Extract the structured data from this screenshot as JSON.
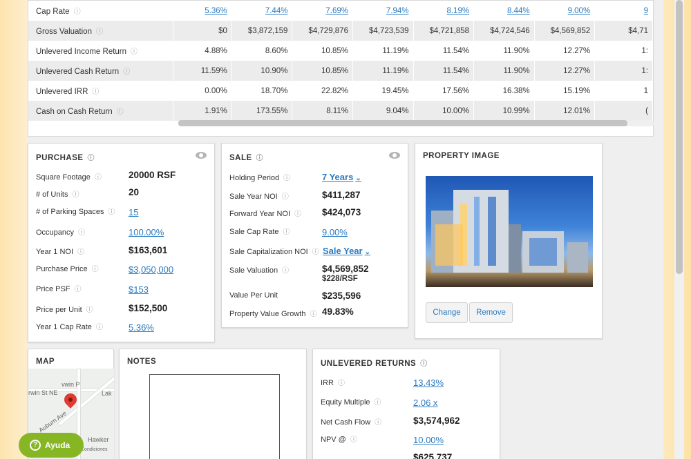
{
  "metrics_table": {
    "rows": [
      {
        "label": "Cap Rate",
        "link": true,
        "values": [
          "5.36%",
          "7.44%",
          "7.69%",
          "7.94%",
          "8.19%",
          "8.44%",
          "9.00%",
          "9"
        ]
      },
      {
        "label": "Gross Valuation",
        "link": false,
        "values": [
          "$0",
          "$3,872,159",
          "$4,729,876",
          "$4,723,539",
          "$4,721,858",
          "$4,724,546",
          "$4,569,852",
          "$4,71"
        ]
      },
      {
        "label": "Unlevered Income Return",
        "link": false,
        "values": [
          "4.88%",
          "8.60%",
          "10.85%",
          "11.19%",
          "11.54%",
          "11.90%",
          "12.27%",
          "1:"
        ]
      },
      {
        "label": "Unlevered Cash Return",
        "link": false,
        "values": [
          "11.59%",
          "10.90%",
          "10.85%",
          "11.19%",
          "11.54%",
          "11.90%",
          "12.27%",
          "1:"
        ]
      },
      {
        "label": "Unlevered IRR",
        "link": false,
        "values": [
          "0.00%",
          "18.70%",
          "22.82%",
          "19.45%",
          "17.56%",
          "16.38%",
          "15.19%",
          "1"
        ]
      },
      {
        "label": "Cash on Cash Return",
        "link": false,
        "values": [
          "1.91%",
          "173.55%",
          "8.11%",
          "9.04%",
          "10.00%",
          "10.99%",
          "12.01%",
          "("
        ]
      }
    ]
  },
  "purchase": {
    "title": "PURCHASE",
    "square_footage_label": "Square Footage",
    "square_footage": "20000 RSF",
    "units_label": "# of Units",
    "units": "20",
    "parking_label": "# of Parking Spaces",
    "parking": "15",
    "occupancy_label": "Occupancy",
    "occupancy": "100.00%",
    "noi_label": "Year 1 NOI",
    "noi": "$163,601",
    "price_label": "Purchase Price",
    "price": "$3,050,000",
    "psf_label": "Price PSF",
    "psf": "$153",
    "per_unit_label": "Price per Unit",
    "per_unit": "$152,500",
    "cap_label": "Year 1 Cap Rate",
    "cap": "5.36%"
  },
  "sale": {
    "title": "SALE",
    "holding_label": "Holding Period",
    "holding": "7 Years",
    "sale_noi_label": "Sale Year NOI",
    "sale_noi": "$411,287",
    "fwd_noi_label": "Forward Year NOI",
    "fwd_noi": "$424,073",
    "cap_label": "Sale Cap Rate",
    "cap": "9.00%",
    "cap_noi_label": "Sale Capitalization NOI",
    "cap_noi": "Sale Year",
    "valuation_label": "Sale Valuation",
    "valuation": "$4,569,852",
    "valuation_rsf": "$228/RSF",
    "per_unit_label": "Value Per Unit",
    "per_unit": "$235,596",
    "growth_label": "Property Value Growth",
    "growth": "49.83%"
  },
  "property_image": {
    "title": "PROPERTY IMAGE",
    "change_label": "Change",
    "remove_label": "Remove"
  },
  "map": {
    "title": "MAP",
    "labels": [
      "vwin P",
      "rwin St NE",
      "Lak",
      "Auburn Ave",
      "Hawker",
      "Condiciones"
    ]
  },
  "notes": {
    "title": "NOTES"
  },
  "unlevered_returns": {
    "title": "UNLEVERED RETURNS",
    "irr_label": "IRR",
    "irr": "13.43%",
    "multiple_label": "Equity Multiple",
    "multiple": "2.06 x",
    "cash_flow_label": "Net Cash Flow",
    "cash_flow": "$3,574,962",
    "npv_label": "NPV @",
    "npv": "10.00%",
    "npv_value": "$625,737"
  },
  "help": {
    "label": "Ayuda"
  },
  "colors": {
    "link": "#2a7bc1",
    "help_green": "#86b624",
    "pin_red": "#e03b2f"
  }
}
